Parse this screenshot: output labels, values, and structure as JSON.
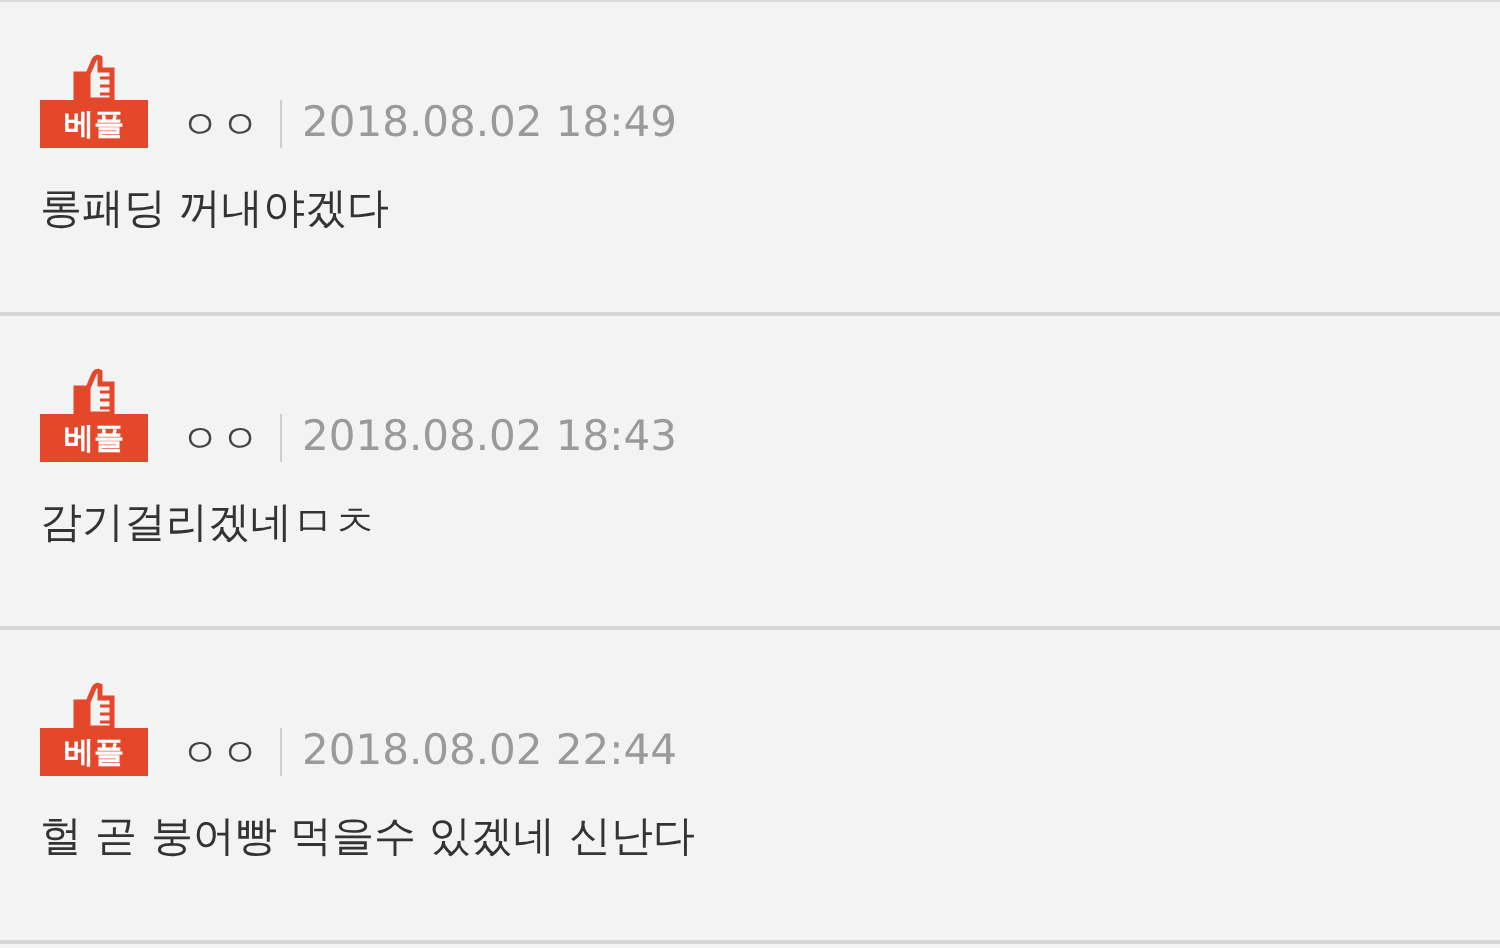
{
  "comments": [
    {
      "badge": "베플",
      "author": "ㅇㅇ",
      "date": "2018.08.02 18:49",
      "text": "롱패딩 꺼내야겠다"
    },
    {
      "badge": "베플",
      "author": "ㅇㅇ",
      "date": "2018.08.02 18:43",
      "text": "감기걸리겠네ㅁㅊ"
    },
    {
      "badge": "베플",
      "author": "ㅇㅇ",
      "date": "2018.08.02 22:44",
      "text": "헐 곧 붕어빵 먹을수 있겠네 신난다"
    }
  ]
}
